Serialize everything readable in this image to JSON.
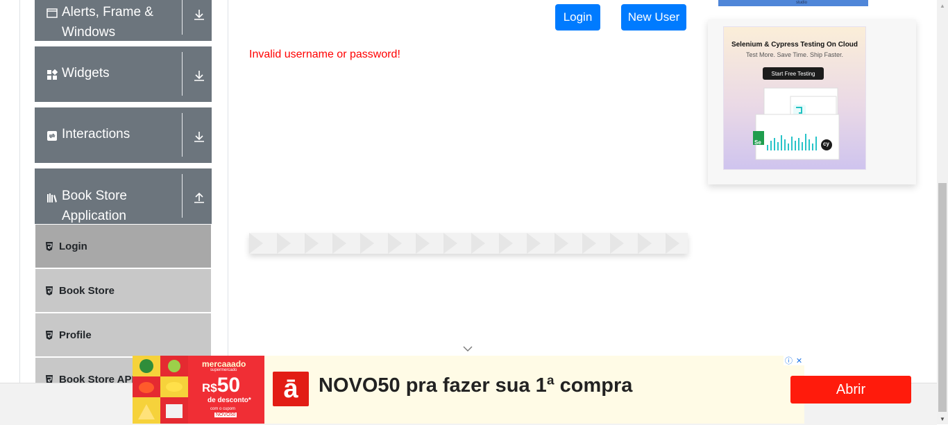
{
  "sidebar": {
    "groups": [
      {
        "label_line1": "Alerts, Frame &",
        "label_line2": "Windows",
        "icon": "window-icon",
        "arrow": "download-arrow-icon"
      },
      {
        "label": "Widgets",
        "icon": "widgets-icon",
        "arrow": "download-arrow-icon"
      },
      {
        "label": "Interactions",
        "icon": "interactions-icon",
        "arrow": "download-arrow-icon"
      },
      {
        "label_line1": "Book Store",
        "label_line2": "Application",
        "icon": "books-icon",
        "arrow": "upload-arrow-icon"
      }
    ],
    "items": [
      {
        "label": "Login",
        "active": true
      },
      {
        "label": "Book Store"
      },
      {
        "label": "Profile"
      },
      {
        "label": "Book Store API"
      }
    ]
  },
  "main": {
    "login_button": "Login",
    "new_user_button": "New User",
    "error_message": "Invalid username or password!"
  },
  "ads": {
    "top_strip_text": "studio",
    "card_title": "Selenium & Cypress Testing On Cloud",
    "card_subtitle": "Test More. Save Time. Ship Faster.",
    "card_cta": "Start Free Testing",
    "card_badge_se": "Se",
    "card_badge_cy": "cy",
    "bottom_brand": "mercaaado",
    "bottom_brand_sub": "supermercado",
    "bottom_currency": "R$",
    "bottom_amount": "50",
    "bottom_discount": "de desconto*",
    "bottom_coupon_prefix": "com o cupom",
    "bottom_code": "NOVO50",
    "bottom_headline": "NOVO50 pra fazer sua 1ª compra",
    "bottom_open_button": "Abrir",
    "bottom_logo_glyph": "ā",
    "info_icon": "ⓘ",
    "close_icon": "✕"
  },
  "colors": {
    "sidebar_header": "#6c757d",
    "primary_button": "#007bff",
    "error": "#ff0000",
    "ad_yellow": "#fde92b",
    "ad_red": "#ff1b0c"
  }
}
